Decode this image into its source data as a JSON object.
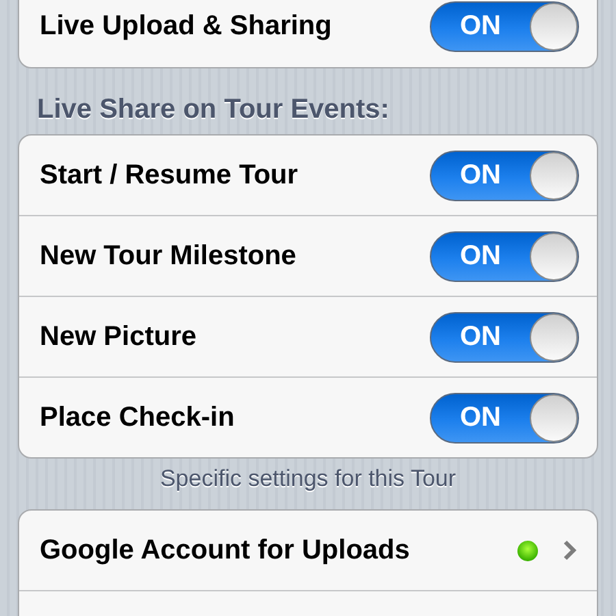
{
  "main_group": [
    {
      "label": "Live Upload & Sharing",
      "toggle_text": "ON",
      "on": true
    }
  ],
  "events_header": "Live Share on Tour Events:",
  "events": [
    {
      "label": "Start / Resume Tour",
      "toggle_text": "ON",
      "on": true
    },
    {
      "label": "New Tour Milestone",
      "toggle_text": "ON",
      "on": true
    },
    {
      "label": "New Picture",
      "toggle_text": "ON",
      "on": true
    },
    {
      "label": "Place Check-in",
      "toggle_text": "ON",
      "on": true
    }
  ],
  "events_footer": "Specific settings for this Tour",
  "accounts": [
    {
      "label": "Google Account for Uploads",
      "connected": true
    }
  ]
}
